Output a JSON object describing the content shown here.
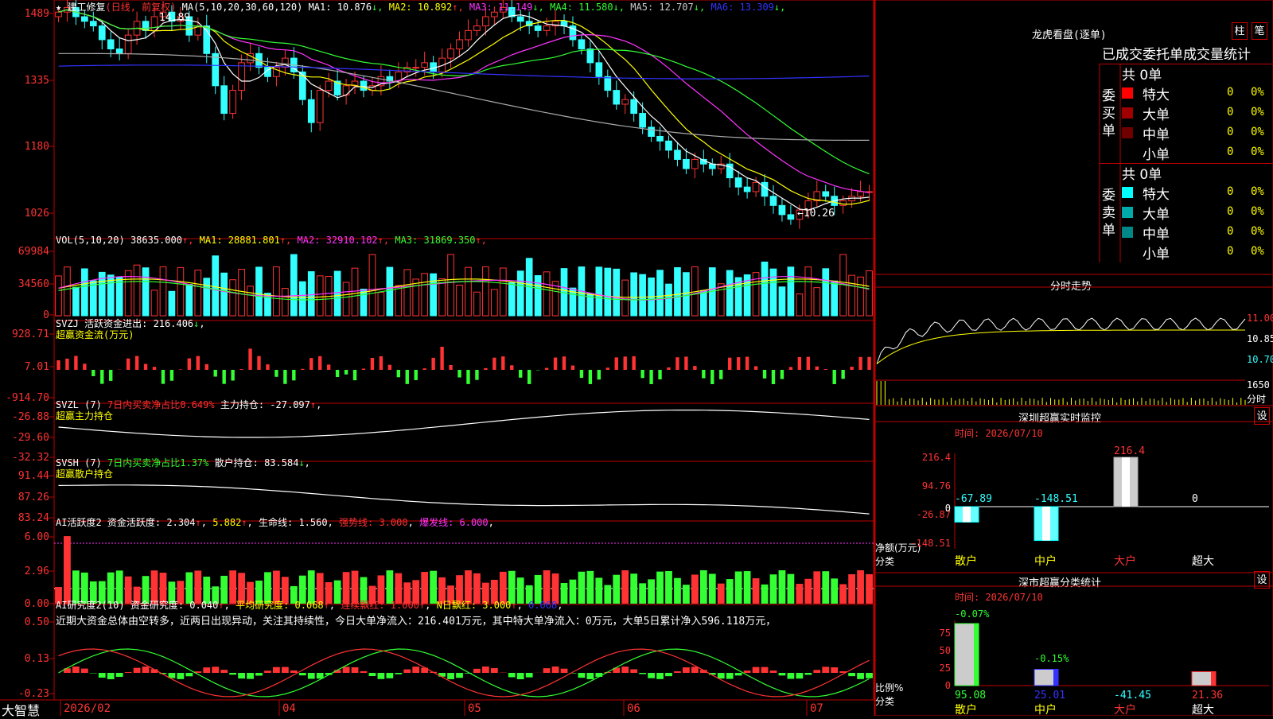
{
  "app_name": "大智慧",
  "stock": {
    "star": "★",
    "name": "建工修复",
    "period": "(日线, 前复权)"
  },
  "colors": {
    "up": "#ff3333",
    "down": "#33ffff",
    "bg": "#000000",
    "border": "#bb0000",
    "green": "#33ff33",
    "yellow": "#ffff00",
    "magenta": "#ff33ff",
    "white": "#ffffff",
    "gray": "#aaaaaa",
    "blue": "#3333ff"
  },
  "price_panel": {
    "ma_label": "MA(5,10,20,30,60,120)",
    "ma_items": [
      {
        "label": "MA1: 10.876",
        "arrow": "↓",
        "color": "#ffffff"
      },
      {
        "label": "MA2: 10.892",
        "arrow": "↑",
        "color": "#ffff00"
      },
      {
        "label": "MA3: 11.149",
        "arrow": "↓",
        "color": "#ff33ff"
      },
      {
        "label": "MA4: 11.580",
        "arrow": "↓",
        "color": "#33ff33"
      },
      {
        "label": "MA5: 12.707",
        "arrow": "↓",
        "color": "#cccccc"
      },
      {
        "label": "MA6: 13.309",
        "arrow": "↓",
        "color": "#3333ff"
      }
    ],
    "y_ticks": [
      "1489",
      "1335",
      "1180",
      "1026"
    ],
    "high_label": "14.89",
    "low_label": "10.26"
  },
  "vol_panel": {
    "label": "VOL(5,10,20)",
    "items": [
      {
        "label": "38635.000",
        "arrow": "↑",
        "color": "#ffffff"
      },
      {
        "label": "MA1: 28881.801",
        "arrow": "↑",
        "color": "#ffff00"
      },
      {
        "label": "MA2: 32910.102",
        "arrow": "↑",
        "color": "#ff33ff"
      },
      {
        "label": "MA3: 31869.350",
        "arrow": "↑",
        "color": "#33ff33"
      }
    ],
    "y_ticks": [
      "69984",
      "34560",
      "0"
    ]
  },
  "svzj_panel": {
    "label": "SVZJ  活跃资金进出: 216.406",
    "arrow": "↓",
    "sub": "超赢资金流(万元)",
    "y_ticks": [
      "928.71",
      "7.01",
      "-914.70"
    ]
  },
  "svzl_panel": {
    "label": "SVZL (7)",
    "pct": "7日内买卖净占比0.649%",
    "extra": "主力持仓: -27.097",
    "arrow": "↑",
    "sub": "超赢主力持仓",
    "y_ticks": [
      "-26.88",
      "-29.60",
      "-32.32"
    ]
  },
  "svsh_panel": {
    "label": "SVSH (7)",
    "pct": "7日内买卖净占比1.37%",
    "extra": "散户持仓: 83.584",
    "arrow": "↓",
    "sub": "超赢散户持仓",
    "y_ticks": [
      "91.44",
      "87.26",
      "83.24"
    ]
  },
  "ai_act_panel": {
    "label": "AI活跃度2",
    "v1": "资金活跃度: 2.304",
    "v2": "5.882",
    "v3": "生命线: 1.560",
    "v4": "强势线: 3.000",
    "v5": "爆发线: 6.000",
    "y_ticks": [
      "6.00",
      "2.96",
      "0.00"
    ]
  },
  "ai_res_panel": {
    "label": "AI研究度2(10)",
    "v1": "资金研究度: 0.040",
    "v2": "平均研究度: 0.068",
    "v3": "连续飘红: 1.000",
    "v4": "N日飘红: 3.000",
    "v5": "0.068",
    "note": "近期大资金总体由空转多，近两日出现异动，关注其持续性，今日大单净流入：216.401万元，其中特大单净流入：0万元，大单5日累计净入596.118万元，",
    "y_ticks": [
      "0.50",
      "0.13",
      "-0.23"
    ]
  },
  "x_axis": {
    "labels": [
      "2026/02",
      "04",
      "05",
      "06",
      "07"
    ]
  },
  "right": {
    "dragon_title": "龙虎看盘(逐单)",
    "btn_zhu": "柱",
    "btn_bi": "笔",
    "stats_title": "已成交委托单成交量统计",
    "buy_side": "委买单",
    "sell_side": "委卖单",
    "buy_total": "共 0单",
    "sell_total": "共 0单",
    "buy_rows": [
      {
        "name": "特大",
        "value": "0",
        "pct": "0%",
        "color": "#ff0000"
      },
      {
        "name": "大单",
        "value": "0",
        "pct": "0%",
        "color": "#a00000"
      },
      {
        "name": "中单",
        "value": "0",
        "pct": "0%",
        "color": "#700000"
      },
      {
        "name": "小单",
        "value": "0",
        "pct": "0%",
        "color": "#000000"
      }
    ],
    "sell_rows": [
      {
        "name": "特大",
        "value": "0",
        "pct": "0%",
        "color": "#00ffff"
      },
      {
        "name": "大单",
        "value": "0",
        "pct": "0%",
        "color": "#00aaaa"
      },
      {
        "name": "中单",
        "value": "0",
        "pct": "0%",
        "color": "#008888"
      },
      {
        "name": "小单",
        "value": "0",
        "pct": "0%",
        "color": "#000000"
      }
    ],
    "intraday_title": "分时走势",
    "intraday_price_ticks": [
      "11.00",
      "10.85",
      "10.70"
    ],
    "intraday_vol_label": "1650",
    "intraday_x_label": "分时",
    "sz_monitor_title": "深圳超赢实时监控",
    "sz_btn": "设",
    "sz_time": "时间: 2026/07/10",
    "sz_y_ticks": [
      "216.4",
      "94.76",
      "-26.87",
      "-148.51"
    ],
    "sz_unit": "净额(万元)",
    "sz_cat": "分类",
    "sz_categories": [
      "散户",
      "中户",
      "大户",
      "超大"
    ],
    "sz_values": [
      "-67.89",
      "-148.51",
      "216.4",
      "0"
    ],
    "sz_zero": "0",
    "sc_title": "深市超赢分类统计",
    "sc_btn": "设",
    "sc_time": "时间: 2026/07/10",
    "sc_y_ticks": [
      "75",
      "50",
      "25",
      "0"
    ],
    "sc_unit": "比例%",
    "sc_cat": "分类",
    "sc_categories": [
      "散户",
      "中户",
      "大户",
      "超大"
    ],
    "sc_pct": [
      "-0.07%",
      "-0.15%"
    ],
    "sc_values": [
      "95.08",
      "25.01",
      "-41.45",
      "21.36"
    ]
  },
  "chart_data": {
    "type": "candlestick",
    "title": "建工修复 (日线, 前复权)",
    "ohlc_series": "daily",
    "close_values": [
      14.8,
      14.9,
      14.7,
      14.6,
      14.5,
      14.2,
      14.0,
      13.9,
      14.3,
      14.6,
      14.4,
      14.7,
      14.8,
      14.6,
      14.7,
      14.3,
      14.5,
      13.9,
      13.2,
      12.6,
      13.1,
      13.7,
      13.9,
      13.6,
      13.4,
      13.6,
      13.8,
      13.5,
      12.9,
      12.4,
      13.1,
      13.3,
      13.0,
      13.2,
      13.3,
      13.1,
      13.2,
      13.4,
      13.3,
      13.5,
      13.6,
      13.6,
      13.7,
      13.5,
      13.8,
      14.0,
      14.2,
      14.4,
      14.5,
      14.7,
      14.8,
      14.9,
      14.7,
      14.6,
      14.5,
      14.4,
      14.5,
      14.6,
      14.5,
      14.2,
      14.0,
      13.7,
      13.4,
      13.1,
      12.8,
      12.9,
      12.6,
      12.3,
      12.1,
      12.0,
      11.8,
      11.6,
      11.4,
      11.6,
      11.5,
      11.4,
      11.5,
      11.2,
      11.0,
      10.9,
      11.1,
      10.8,
      10.6,
      10.4,
      10.3,
      10.5,
      10.7,
      10.9,
      10.8,
      10.6,
      10.7,
      10.8,
      10.9,
      10.9
    ],
    "y_range": [
      10.26,
      14.89
    ],
    "x_labels": [
      "2026/02",
      "04",
      "05",
      "06",
      "07"
    ]
  }
}
